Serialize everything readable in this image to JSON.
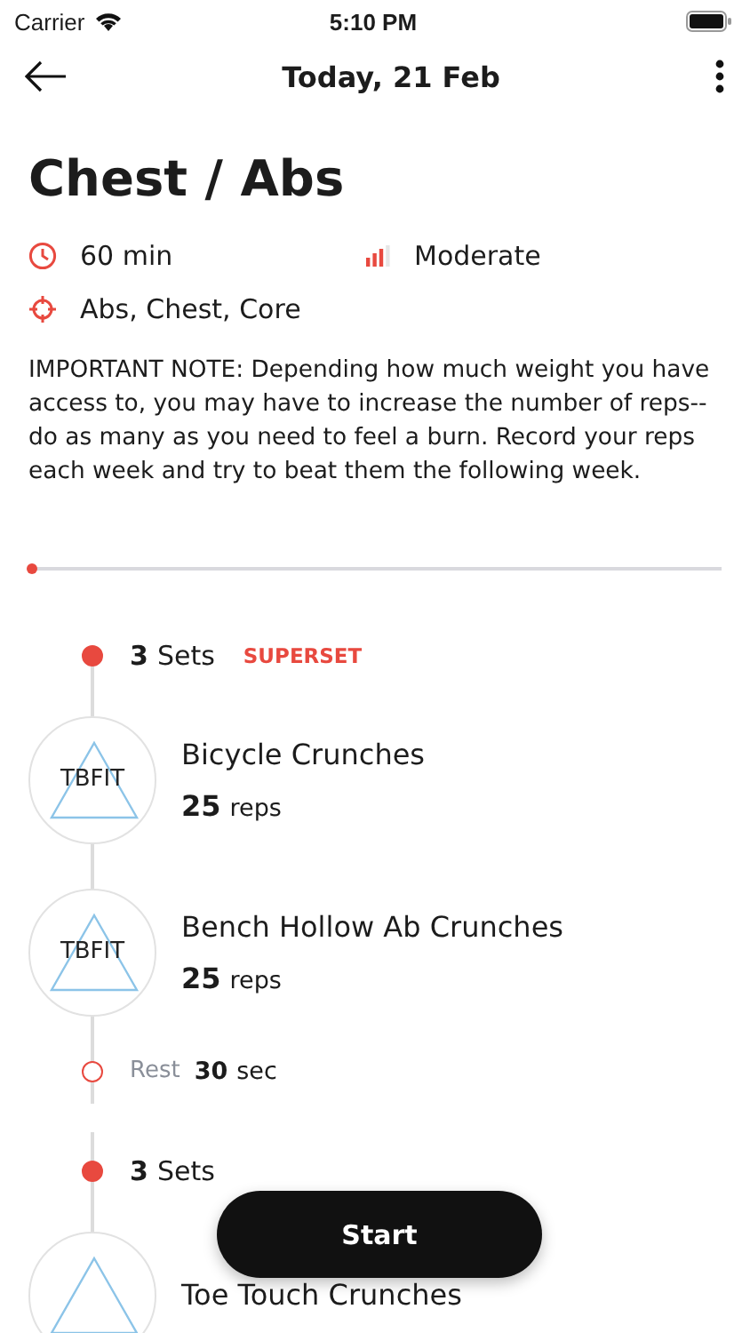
{
  "status_bar": {
    "carrier": "Carrier",
    "time": "5:10 PM"
  },
  "header": {
    "title": "Today, 21 Feb"
  },
  "workout": {
    "title": "Chest / Abs",
    "duration": "60 min",
    "intensity": "Moderate",
    "muscles": "Abs, Chest, Core",
    "note": "IMPORTANT NOTE: Depending how much weight you have access to, you may have to increase the number of reps-- do as many as you need to feel a burn. Record your reps each week and try to beat them the following week."
  },
  "progress": {
    "level": 0
  },
  "timeline": [
    {
      "kind": "set",
      "count": "3",
      "unit": "Sets",
      "tag": "SUPERSET"
    },
    {
      "kind": "exercise",
      "logo": "TBFIT",
      "name": "Bicycle Crunches",
      "count": "25",
      "unit": "reps"
    },
    {
      "kind": "exercise",
      "logo": "TBFIT",
      "name": "Bench Hollow Ab Crunches",
      "count": "25",
      "unit": "reps"
    },
    {
      "kind": "rest",
      "label": "Rest",
      "count": "30",
      "unit": "sec"
    },
    {
      "kind": "set",
      "count": "3",
      "unit": "Sets"
    },
    {
      "kind": "exercise",
      "name": "Toe Touch Crunches"
    }
  ],
  "start_button": "Start"
}
